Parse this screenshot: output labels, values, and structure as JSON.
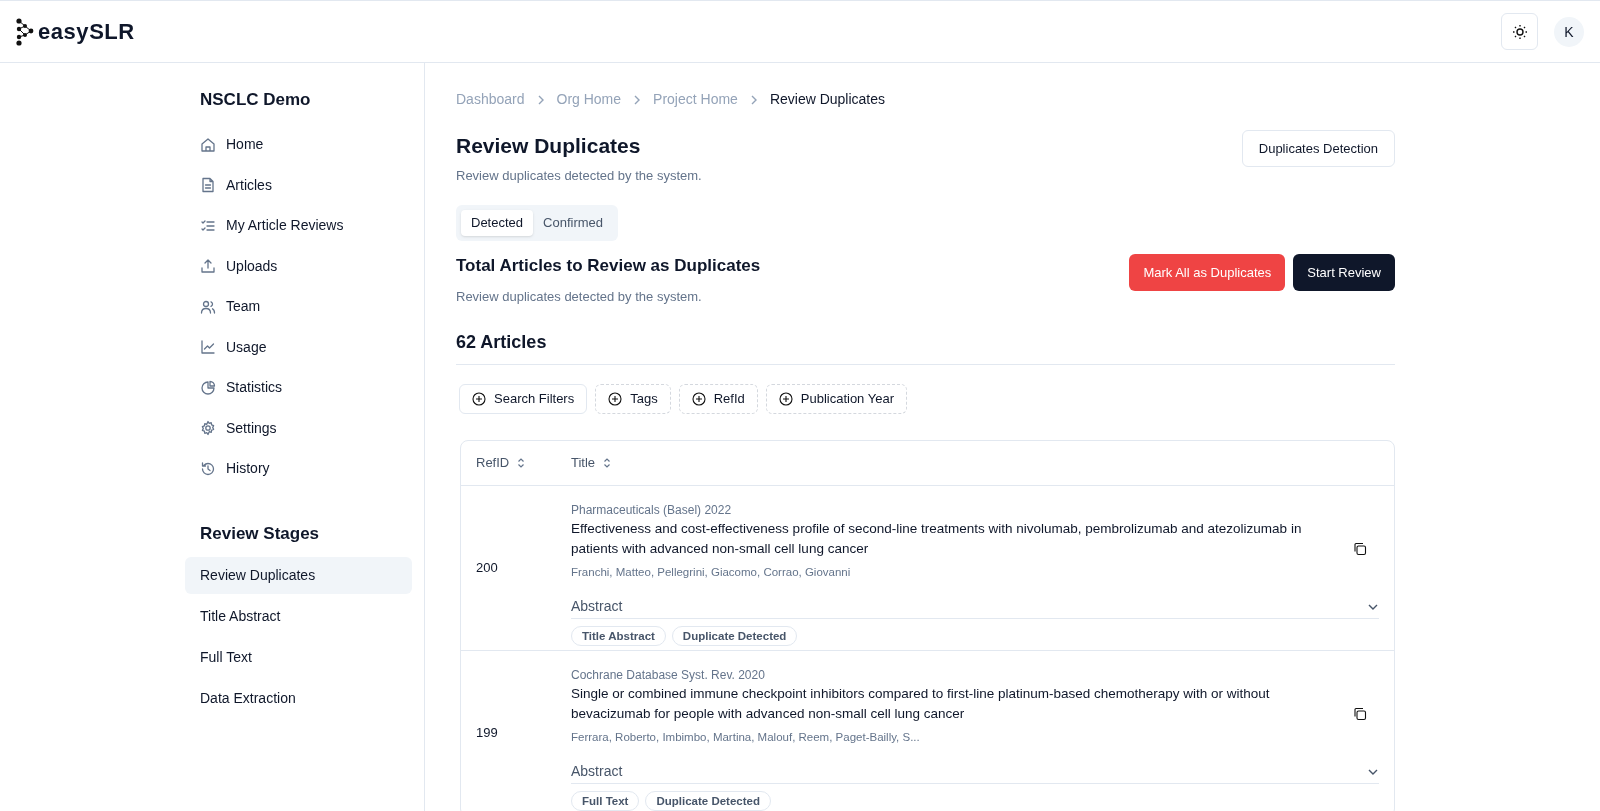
{
  "header": {
    "logo": "easySLR",
    "avatar": "K"
  },
  "sidebar": {
    "project": "NSCLC Demo",
    "items": [
      {
        "label": "Home",
        "selected": false
      },
      {
        "label": "Articles",
        "selected": false
      },
      {
        "label": "My Article Reviews",
        "selected": false
      },
      {
        "label": "Uploads",
        "selected": false
      },
      {
        "label": "Team",
        "selected": false
      },
      {
        "label": "Usage",
        "selected": false
      },
      {
        "label": "Statistics",
        "selected": false
      },
      {
        "label": "Settings",
        "selected": false
      },
      {
        "label": "History",
        "selected": false
      }
    ],
    "stages_title": "Review Stages",
    "stages": [
      {
        "label": "Review Duplicates",
        "selected": true
      },
      {
        "label": "Title Abstract",
        "selected": false
      },
      {
        "label": "Full Text",
        "selected": false
      },
      {
        "label": "Data Extraction",
        "selected": false
      }
    ]
  },
  "breadcrumbs": [
    "Dashboard",
    "Org Home",
    "Project Home",
    "Review Duplicates"
  ],
  "page": {
    "title": "Review Duplicates",
    "subtitle": "Review duplicates detected by the system.",
    "action": "Duplicates Detection"
  },
  "tabs": [
    {
      "label": "Detected",
      "selected": true
    },
    {
      "label": "Confirmed",
      "selected": false
    }
  ],
  "section": {
    "title": "Total Articles to Review as Duplicates",
    "subtitle": "Review duplicates detected by the system.",
    "buttons": [
      {
        "label": "Mark All as Duplicates",
        "kind": "danger"
      },
      {
        "label": "Start Review",
        "kind": "primary"
      }
    ]
  },
  "count": "62 Articles",
  "filters": [
    {
      "label": "Search Filters",
      "kind": "solid"
    },
    {
      "label": "Tags",
      "kind": "dashed"
    },
    {
      "label": "RefId",
      "kind": "dashed"
    },
    {
      "label": "Publication Year",
      "kind": "dashed"
    }
  ],
  "table": {
    "columns": [
      "RefID",
      "Title"
    ],
    "rows": [
      {
        "refid": "200",
        "journal": "Pharmaceuticals (Basel) 2022",
        "title": "Effectiveness and cost-effectiveness profile of second-line treatments with nivolumab, pembrolizumab and atezolizumab in patients with advanced non-small cell lung cancer",
        "authors": "Franchi, Matteo, Pellegrini, Giacomo, Corrao, Giovanni",
        "abstract": "Abstract",
        "tags": [
          "Title Abstract",
          "Duplicate Detected"
        ]
      },
      {
        "refid": "199",
        "journal": "Cochrane Database Syst. Rev. 2020",
        "title": "Single or combined immune checkpoint inhibitors compared to first-line platinum-based chemotherapy with or without bevacizumab for people with advanced non-small cell lung cancer",
        "authors": "Ferrara, Roberto, Imbimbo, Martina, Malouf, Reem, Paget-Bailly, S...",
        "abstract": "Abstract",
        "tags": [
          "Full Text",
          "Duplicate Detected"
        ]
      }
    ]
  }
}
